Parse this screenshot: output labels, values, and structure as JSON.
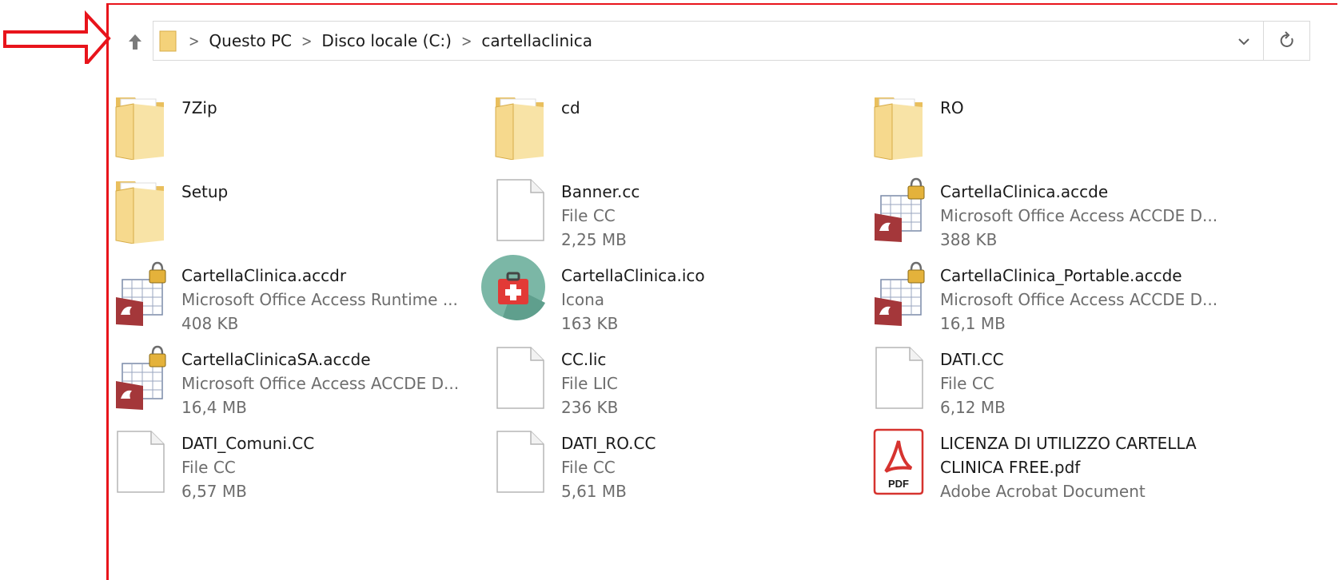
{
  "breadcrumb": [
    "Questo PC",
    "Disco locale (C:)",
    "cartellaclinica"
  ],
  "files": [
    {
      "name": "7Zip",
      "lines": [],
      "icon": "folder-icon"
    },
    {
      "name": "cd",
      "lines": [],
      "icon": "folder-icon"
    },
    {
      "name": "RO",
      "lines": [],
      "icon": "folder-icon"
    },
    {
      "name": "Setup",
      "lines": [],
      "icon": "folder-icon"
    },
    {
      "name": "Banner.cc",
      "lines": [
        "File CC",
        "2,25 MB"
      ],
      "icon": "generic-file-icon"
    },
    {
      "name": "CartellaClinica.accde",
      "lines": [
        "Microsoft Office Access ACCDE D...",
        "388 KB"
      ],
      "icon": "access-locked-icon"
    },
    {
      "name": "CartellaClinica.accdr",
      "lines": [
        "Microsoft Office Access Runtime ...",
        "408 KB"
      ],
      "icon": "access-locked-icon"
    },
    {
      "name": "CartellaClinica.ico",
      "lines": [
        "Icona",
        "163 KB"
      ],
      "icon": "medical-kit-icon"
    },
    {
      "name": "CartellaClinica_Portable.accde",
      "lines": [
        "Microsoft Office Access ACCDE D...",
        "16,1 MB"
      ],
      "icon": "access-locked-icon"
    },
    {
      "name": "CartellaClinicaSA.accde",
      "lines": [
        "Microsoft Office Access ACCDE D...",
        "16,4 MB"
      ],
      "icon": "access-locked-icon"
    },
    {
      "name": "CC.lic",
      "lines": [
        "File LIC",
        "236 KB"
      ],
      "icon": "generic-file-icon"
    },
    {
      "name": "DATI.CC",
      "lines": [
        "File CC",
        "6,12 MB"
      ],
      "icon": "generic-file-icon"
    },
    {
      "name": "DATI_Comuni.CC",
      "lines": [
        "File CC",
        "6,57 MB"
      ],
      "icon": "generic-file-icon"
    },
    {
      "name": "DATI_RO.CC",
      "lines": [
        "File CC",
        "5,61 MB"
      ],
      "icon": "generic-file-icon"
    },
    {
      "name": "LICENZA DI UTILIZZO CARTELLA CLINICA FREE.pdf",
      "lines": [
        "Adobe Acrobat Document"
      ],
      "icon": "pdf-icon",
      "pdf_label": "PDF"
    }
  ],
  "colors": {
    "annotation": "#e8141b",
    "folder": "#f4d27a",
    "accent_access": "#a4373a"
  }
}
